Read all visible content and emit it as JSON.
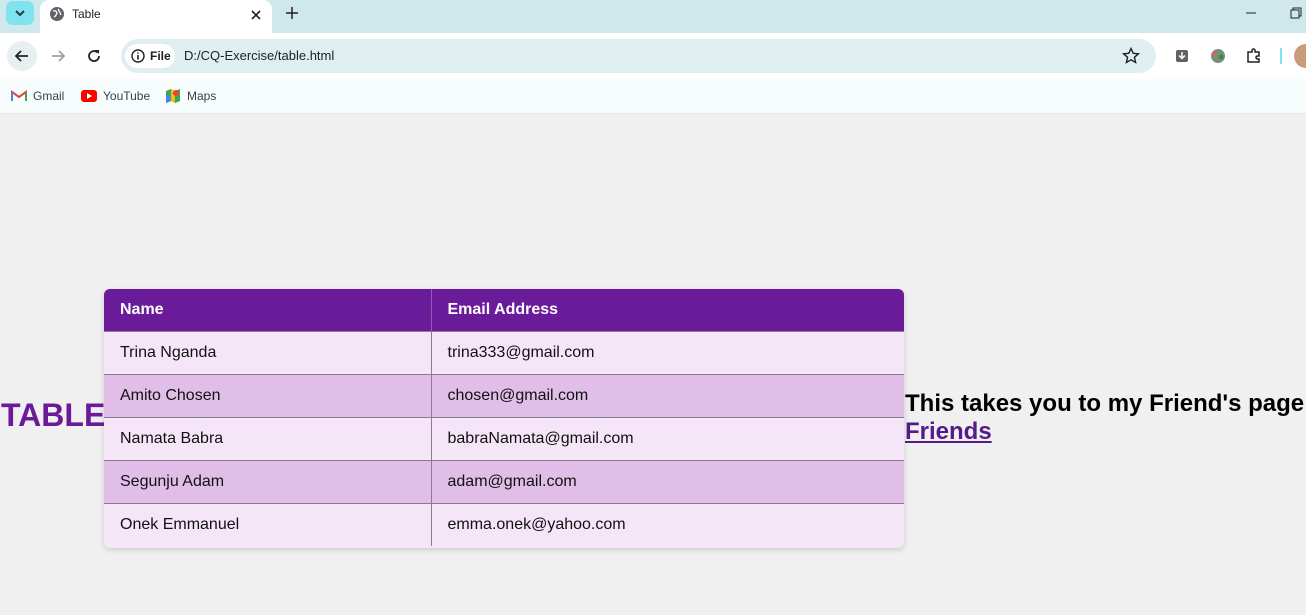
{
  "browser": {
    "tab_title": "Table",
    "site_chip_label": "File",
    "url": "D:/CQ-Exercise/table.html",
    "bookmarks": [
      {
        "label": "Gmail",
        "icon": "gmail-icon"
      },
      {
        "label": "YouTube",
        "icon": "youtube-icon"
      },
      {
        "label": "Maps",
        "icon": "maps-icon"
      }
    ]
  },
  "page": {
    "heading": "TABLE",
    "table": {
      "headers": [
        "Name",
        "Email Address"
      ],
      "rows": [
        [
          "Trina Nganda",
          "trina333@gmail.com"
        ],
        [
          "Amito Chosen",
          "chosen@gmail.com"
        ],
        [
          "Namata Babra",
          "babraNamata@gmail.com"
        ],
        [
          "Segunju Adam",
          "adam@gmail.com"
        ],
        [
          "Onek Emmanuel",
          "emma.onek@yahoo.com"
        ]
      ]
    },
    "side_text": "This takes you to my Friend's page",
    "link_label": "Friends"
  },
  "colors": {
    "accent": "#6a1b9a",
    "row_light": "#f5e6f7",
    "row_dark": "#e1bee7",
    "link": "#551a8b"
  }
}
